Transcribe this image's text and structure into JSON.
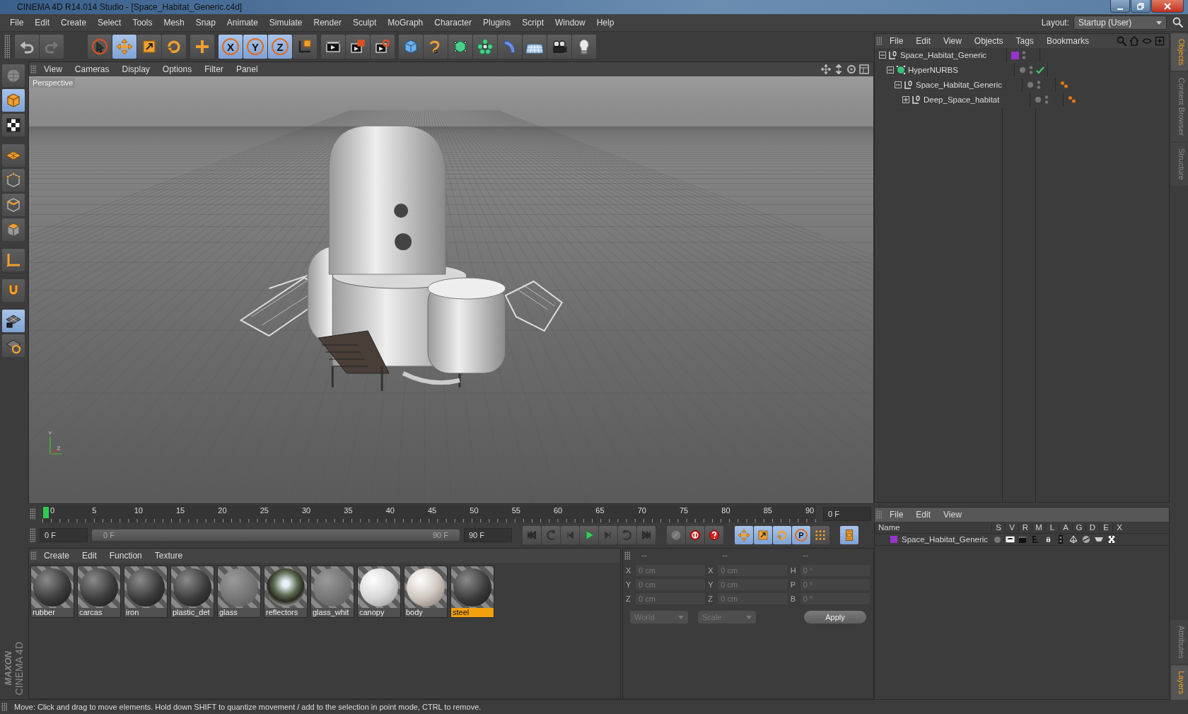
{
  "window": {
    "title": "CINEMA 4D R14.014 Studio - [Space_Habitat_Generic.c4d]"
  },
  "menu": [
    "File",
    "Edit",
    "Create",
    "Select",
    "Tools",
    "Mesh",
    "Snap",
    "Animate",
    "Simulate",
    "Render",
    "Sculpt",
    "MoGraph",
    "Character",
    "Plugins",
    "Script",
    "Window",
    "Help"
  ],
  "layout": {
    "label": "Layout:",
    "value": "Startup (User)"
  },
  "toolbar": [
    [
      {
        "kind": "undo",
        "selected": false
      },
      {
        "kind": "redo",
        "selected": false
      }
    ],
    [
      {
        "kind": "pointer",
        "selected": false
      },
      {
        "kind": "move",
        "selected": true
      },
      {
        "kind": "scale",
        "selected": false
      },
      {
        "kind": "rotate",
        "selected": false
      }
    ],
    [
      {
        "kind": "add",
        "selected": false
      }
    ],
    [
      {
        "kind": "axis-letter",
        "label": "X",
        "selected": true
      },
      {
        "kind": "axis-letter",
        "label": "Y",
        "selected": true
      },
      {
        "kind": "axis-letter",
        "label": "Z",
        "selected": true
      },
      {
        "kind": "coord",
        "selected": false
      }
    ],
    [
      {
        "kind": "render-view",
        "selected": false
      },
      {
        "kind": "render-picture",
        "selected": false
      },
      {
        "kind": "render-settings",
        "selected": false
      }
    ],
    [
      {
        "kind": "cube",
        "selected": false
      },
      {
        "kind": "spline",
        "selected": false
      },
      {
        "kind": "nurbs",
        "selected": false
      },
      {
        "kind": "array",
        "selected": false
      },
      {
        "kind": "deformer",
        "selected": false
      },
      {
        "kind": "floor",
        "selected": false
      },
      {
        "kind": "camera",
        "selected": false
      },
      {
        "kind": "light",
        "selected": false
      }
    ]
  ],
  "left_toolbar": [
    {
      "kind": "make-editable",
      "selected": false
    },
    {
      "kind": "model",
      "selected": true
    },
    {
      "kind": "texture",
      "selected": false
    },
    {
      "kind": "workplane",
      "selected": false
    },
    {
      "kind": "points",
      "selected": false
    },
    {
      "kind": "edges",
      "selected": false
    },
    {
      "kind": "polygons",
      "selected": false
    },
    {
      "kind": "axis",
      "selected": false
    },
    {
      "kind": "magnet",
      "selected": false
    },
    {
      "kind": "lock",
      "selected": true
    },
    {
      "kind": "quantize",
      "selected": false
    }
  ],
  "brand": {
    "company": "MAXON",
    "product": "CINEMA 4D"
  },
  "viewport": {
    "menu": [
      "View",
      "Cameras",
      "Display",
      "Options",
      "Filter",
      "Panel"
    ],
    "camera": "Perspective"
  },
  "timeline": {
    "ticks": [
      "0",
      "5",
      "10",
      "15",
      "20",
      "25",
      "30",
      "35",
      "40",
      "45",
      "50",
      "55",
      "60",
      "65",
      "70",
      "75",
      "80",
      "85",
      "90"
    ],
    "level": 0,
    "current": "0 F",
    "start": "0 F",
    "range": {
      "level": 1,
      "start": "0 F",
      "end": "90 F"
    },
    "end": "90 F",
    "transport": [
      {
        "kind": "first",
        "selected": false
      },
      {
        "kind": "prev-key",
        "selected": false
      },
      {
        "kind": "prev",
        "selected": false
      },
      {
        "kind": "play",
        "selected": false
      },
      {
        "kind": "next",
        "selected": false
      },
      {
        "kind": "next-key",
        "selected": false
      },
      {
        "kind": "last",
        "selected": false
      }
    ],
    "record": [
      {
        "kind": "keyframe",
        "selected": false
      },
      {
        "kind": "record",
        "selected": false
      },
      {
        "kind": "autokey",
        "selected": false
      }
    ],
    "channels": [
      {
        "kind": "move",
        "selected": true
      },
      {
        "kind": "scale",
        "selected": true
      },
      {
        "kind": "rotate",
        "selected": true
      },
      {
        "kind": "param",
        "label": "P",
        "selected": true
      },
      {
        "kind": "pla",
        "selected": false
      }
    ],
    "timeline_window": {
      "kind": "film",
      "selected": true
    }
  },
  "materials": {
    "menu": [
      "Create",
      "Edit",
      "Function",
      "Texture"
    ],
    "items": [
      {
        "name": "rubber",
        "kind": "metal",
        "selected": false
      },
      {
        "name": "carcas",
        "kind": "metal",
        "selected": false
      },
      {
        "name": "iron",
        "kind": "metal",
        "selected": false
      },
      {
        "name": "plastic_det",
        "kind": "metal",
        "selected": false
      },
      {
        "name": "glass",
        "kind": "glass",
        "selected": false
      },
      {
        "name": "reflectors",
        "kind": "chrome",
        "selected": false
      },
      {
        "name": "glass_whit",
        "kind": "glass",
        "selected": false
      },
      {
        "name": "canopy",
        "kind": "white",
        "selected": false
      },
      {
        "name": "body",
        "kind": "decal",
        "selected": false
      },
      {
        "name": "steel",
        "kind": "metal",
        "selected": true
      }
    ]
  },
  "coordinates": {
    "headers": [
      "--",
      "--",
      "--"
    ],
    "rows": [
      {
        "pos_axis": "X",
        "pos": "0 cm",
        "size_axis": "X",
        "size": "0 cm",
        "rot_axis": "H",
        "rot": "0 °"
      },
      {
        "pos_axis": "Y",
        "pos": "0 cm",
        "size_axis": "Y",
        "size": "0 cm",
        "rot_axis": "P",
        "rot": "0 °"
      },
      {
        "pos_axis": "Z",
        "pos": "0 cm",
        "size_axis": "Z",
        "size": "0 cm",
        "rot_axis": "B",
        "rot": "0 °"
      }
    ],
    "mode": "World",
    "size_mode": "Scale",
    "apply": "Apply"
  },
  "objects": {
    "menu": [
      "File",
      "Edit",
      "View",
      "Objects",
      "Tags",
      "Bookmarks"
    ],
    "tree": [
      {
        "name": "Space_Habitat_Generic",
        "kind": "null",
        "expanded": true,
        "color": "#9933cc",
        "children": [
          {
            "name": "HyperNURBS",
            "kind": "nurbs",
            "expanded": true,
            "tags": [
              {
                "kind": "check"
              }
            ],
            "children": [
              {
                "name": "Space_Habitat_Generic",
                "kind": "null",
                "expanded": true,
                "tags": [
                  {
                    "kind": "material"
                  }
                ],
                "children": [
                  {
                    "name": "Deep_Space_habitat",
                    "kind": "null",
                    "expanded": false,
                    "tags": [
                      {
                        "kind": "material"
                      }
                    ]
                  }
                ]
              }
            ]
          }
        ]
      }
    ]
  },
  "side_tabs_top": [
    {
      "label": "Objects",
      "selected": true
    },
    {
      "label": "Content Browser",
      "selected": false
    },
    {
      "label": "Structure",
      "selected": false
    }
  ],
  "layers": {
    "menu": [
      "File",
      "Edit",
      "View"
    ],
    "columns": [
      "Name",
      "S",
      "V",
      "R",
      "M",
      "L",
      "A",
      "G",
      "D",
      "E",
      "X"
    ],
    "rows": [
      {
        "name": "Space_Habitat_Generic",
        "color": "#9933cc"
      }
    ]
  },
  "side_tabs_bottom": [
    {
      "label": "Attributes",
      "selected": false
    },
    {
      "label": "Layers",
      "selected": true
    }
  ],
  "status_bar": "Move: Click and drag to move elements. Hold down SHIFT to quantize movement / add to the selection in point mode, CTRL to remove."
}
